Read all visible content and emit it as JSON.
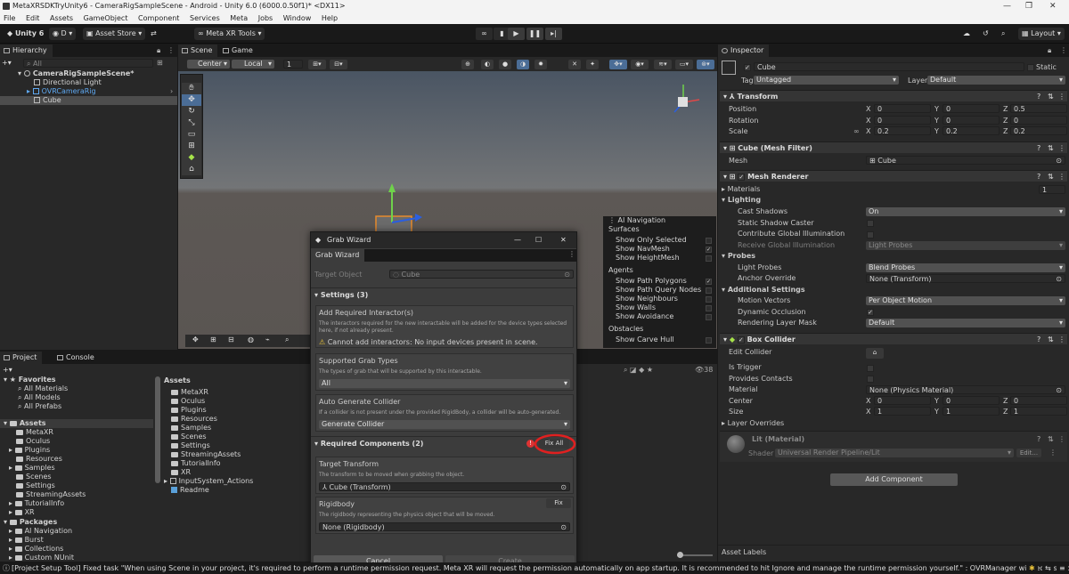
{
  "window": {
    "title": "MetaXRSDKTryUnity6 - CameraRigSampleScene - Android - Unity 6.0 (6000.0.50f1)* <DX11>",
    "controls": [
      "—",
      "❐",
      "✕"
    ]
  },
  "menu": [
    "File",
    "Edit",
    "Assets",
    "GameObject",
    "Component",
    "Services",
    "Meta",
    "Jobs",
    "Window",
    "Help"
  ],
  "toolbar": {
    "unity_label": "Unity 6",
    "account_label": "D",
    "asset_store_label": "Asset Store",
    "meta_xr_tools_label": "Meta XR Tools",
    "layout_label": "Layout"
  },
  "hierarchy": {
    "tab_label": "Hierarchy",
    "search_placeholder": "All",
    "items": [
      {
        "label": "CameraRigSampleScene*"
      },
      {
        "label": "Directional Light"
      },
      {
        "label": "OVRCameraRig"
      },
      {
        "label": "Cube"
      }
    ]
  },
  "scene": {
    "tab_scene": "Scene",
    "tab_game": "Game",
    "pivot_label": "Center",
    "space_label": "Local",
    "grid_value": "1"
  },
  "nav_overlay": {
    "title": "AI Navigation",
    "rows": [
      {
        "label": "Surfaces",
        "check": ""
      },
      {
        "label": "Show Only Selected",
        "check": ""
      },
      {
        "label": "Show NavMesh",
        "check": "✓"
      },
      {
        "label": "Show HeightMesh",
        "check": ""
      },
      {
        "label": "Agents",
        "check": ""
      },
      {
        "label": "Show Path Polygons",
        "check": "✓"
      },
      {
        "label": "Show Path Query Nodes",
        "check": ""
      },
      {
        "label": "Show Neighbours",
        "check": ""
      },
      {
        "label": "Show Walls",
        "check": ""
      },
      {
        "label": "Show Avoidance",
        "check": ""
      },
      {
        "label": "Obstacles",
        "check": ""
      },
      {
        "label": "Show Carve Hull",
        "check": ""
      }
    ]
  },
  "project": {
    "tab_project": "Project",
    "tab_console": "Console",
    "favorites_label": "Favorites",
    "favorites": [
      "All Materials",
      "All Models",
      "All Prefabs"
    ],
    "assets_label": "Assets",
    "asset_tree": [
      "MetaXR",
      "Oculus",
      "Plugins",
      "Resources",
      "Samples",
      "Scenes",
      "Settings",
      "StreamingAssets",
      "TutorialInfo",
      "XR"
    ],
    "packages_label": "Packages",
    "packages": [
      "AI Navigation",
      "Burst",
      "Collections",
      "Custom NUnit"
    ],
    "grid_header": "Assets",
    "grid_items": [
      "MetaXR",
      "Oculus",
      "Plugins",
      "Resources",
      "Samples",
      "Scenes",
      "Settings",
      "StreamingAssets",
      "TutorialInfo",
      "XR",
      "InputSystem_Actions",
      "Readme"
    ],
    "count_label": "38"
  },
  "dialog": {
    "title": "Grab Wizard",
    "tab_label": "Grab Wizard",
    "target_object_label": "Target Object",
    "target_object_value": "Cube",
    "settings_header": "Settings (3)",
    "add_interactors_title": "Add Required Interactor(s)",
    "add_interactors_desc": "The interactors required for the new interactable will be added for the device types selected here, if not already present.",
    "add_interactors_warning": "Cannot add interactors: No input devices present in scene.",
    "grab_types_title": "Supported Grab Types",
    "grab_types_desc": "The types of grab that will be supported by this interactable.",
    "grab_types_value": "All",
    "auto_collider_title": "Auto Generate Collider",
    "auto_collider_desc": "If a collider is not present under the provided RigidBody, a collider will be auto-generated.",
    "auto_collider_value": "Generate Collider",
    "required_header": "Required Components (2)",
    "fix_all_label": "Fix All",
    "target_transform_title": "Target Transform",
    "target_transform_desc": "The transform to be moved when grabbing the object.",
    "target_transform_value": "Cube (Transform)",
    "rigidbody_title": "Rigidbody",
    "rigidbody_desc": "The rigidbody representing the physics object that will be moved.",
    "rigidbody_value": "None (Rigidbody)",
    "fix_label": "Fix",
    "cancel_label": "Cancel",
    "create_label": "Create",
    "highlight_color": "#e02020"
  },
  "inspector": {
    "tab_label": "Inspector",
    "object_name": "Cube",
    "static_label": "Static",
    "tag_label": "Tag",
    "tag_value": "Untagged",
    "layer_label": "Layer",
    "layer_value": "Default",
    "transform": {
      "title": "Transform",
      "position_label": "Position",
      "rotation_label": "Rotation",
      "scale_label": "Scale",
      "position": [
        "0",
        "0",
        "0.5"
      ],
      "rotation": [
        "0",
        "0",
        "0"
      ],
      "scale": [
        "0.2",
        "0.2",
        "0.2"
      ]
    },
    "mesh_filter": {
      "title": "Cube (Mesh Filter)",
      "mesh_label": "Mesh",
      "mesh_value": "Cube"
    },
    "mesh_renderer": {
      "title": "Mesh Renderer",
      "materials_label": "Materials",
      "materials_count": "1",
      "lighting_label": "Lighting",
      "cast_shadows_label": "Cast Shadows",
      "cast_shadows_value": "On",
      "static_shadow_label": "Static Shadow Caster",
      "contribute_gi_label": "Contribute Global Illumination",
      "receive_gi_label": "Receive Global Illumination",
      "receive_gi_value": "Light Probes",
      "probes_label": "Probes",
      "light_probes_label": "Light Probes",
      "light_probes_value": "Blend Probes",
      "anchor_override_label": "Anchor Override",
      "anchor_override_value": "None (Transform)",
      "additional_label": "Additional Settings",
      "motion_vectors_label": "Motion Vectors",
      "motion_vectors_value": "Per Object Motion",
      "dynamic_occlusion_label": "Dynamic Occlusion",
      "rendering_layer_label": "Rendering Layer Mask",
      "rendering_layer_value": "Default"
    },
    "box_collider": {
      "title": "Box Collider",
      "edit_collider_label": "Edit Collider",
      "is_trigger_label": "Is Trigger",
      "provides_contacts_label": "Provides Contacts",
      "material_label": "Material",
      "material_value": "None (Physics Material)",
      "center_label": "Center",
      "size_label": "Size",
      "center": [
        "0",
        "0",
        "0"
      ],
      "size": [
        "1",
        "1",
        "1"
      ],
      "layer_overrides_label": "Layer Overrides"
    },
    "material": {
      "title": "Lit (Material)",
      "shader_label": "Shader",
      "shader_value": "Universal Render Pipeline/Lit",
      "edit_label": "Edit..."
    },
    "add_component_label": "Add Component",
    "asset_labels": "Asset Labels"
  },
  "status_bar": {
    "message": "[Project Setup Tool] Fixed task \"When using Scene in your project, it's required to perform a runtime permission request. Meta XR will request the permission automatically on app startup. It is recommended to hit Ignore and manage the runtime permission yourself.\" : OVRManager will request Scene"
  }
}
